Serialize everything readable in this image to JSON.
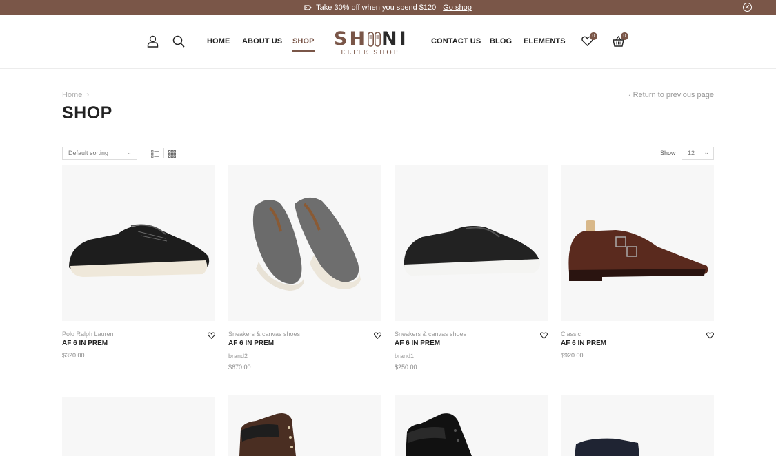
{
  "topbar": {
    "promo_text": "Take 30% off when you spend $120",
    "link": "Go shop"
  },
  "header": {
    "nav_left": [
      "HOME",
      "ABOUT US",
      "SHOP"
    ],
    "nav_right": [
      "CONTACT US",
      "BLOG",
      "ELEMENTS"
    ],
    "logo_main_a": "SH",
    "logo_main_b": "NI",
    "logo_sub": "ELITE SHOP",
    "wishlist_count": "0",
    "cart_count": "0",
    "active": "SHOP"
  },
  "page": {
    "breadcrumb": "Home",
    "breadcrumb_sep": "›",
    "return_link": "Return to previous page",
    "title": "SHOP"
  },
  "toolbar": {
    "sort_label": "Default sorting",
    "show_label": "Show",
    "show_value": "12"
  },
  "products": [
    {
      "category": "Polo Ralph Lauren",
      "name": "AF 6 IN PREM",
      "brand": "",
      "price": "$320.00"
    },
    {
      "category": "Sneakers & canvas shoes",
      "name": "AF 6 IN PREM",
      "brand": "brand2",
      "price": "$670.00"
    },
    {
      "category": "Sneakers & canvas shoes",
      "name": "AF 6 IN PREM",
      "brand": "brand1",
      "price": "$250.00"
    },
    {
      "category": "Classic",
      "name": "AF 6 IN PREM",
      "brand": "",
      "price": "$920.00"
    }
  ],
  "colors": {
    "accent": "#7a5648",
    "text": "#222222",
    "muted": "#999999"
  },
  "icons": {
    "topbar_tag": "tag-icon",
    "close": "close-circle-icon",
    "user": "user-icon",
    "search": "search-icon",
    "wishlist": "heart-icon",
    "cart": "basket-icon"
  }
}
